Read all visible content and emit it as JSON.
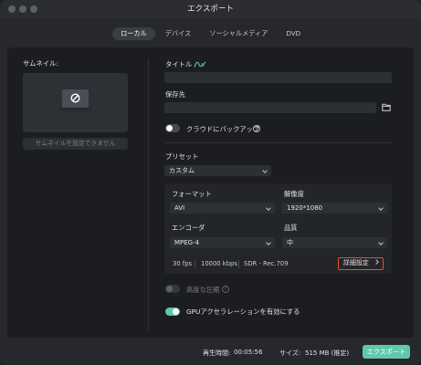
{
  "window": {
    "title": "エクスポート"
  },
  "tabs": [
    {
      "label": "ローカル",
      "active": true
    },
    {
      "label": "デバイス",
      "active": false
    },
    {
      "label": "ソーシャルメディア",
      "active": false
    },
    {
      "label": "DVD",
      "active": false
    }
  ],
  "thumbnail": {
    "label": "サムネイル:",
    "button_label": "サムネイルを設定できません"
  },
  "form": {
    "title_label": "タイトル",
    "title_value": "",
    "save_label": "保存先",
    "save_value": "",
    "backup_label": "クラウドにバックアップ",
    "backup_on": false
  },
  "preset": {
    "label": "プリセット",
    "value": "カスタム"
  },
  "format": {
    "format_label": "フォーマット",
    "format_value": "AVI",
    "resolution_label": "解像度",
    "resolution_value": "1920*1080",
    "encoder_label": "エンコーダ",
    "encoder_value": "MPEG-4",
    "quality_label": "品質",
    "quality_value": "中",
    "fps": "30 fps",
    "bitrate": "10000 kbps",
    "color": "SDR - Rec.709",
    "detail_label": "詳細設定"
  },
  "options": {
    "compress_label": "高度な圧縮",
    "compress_on": false,
    "gpu_label": "GPUアクセラレーションを有効にする",
    "gpu_on": true
  },
  "footer": {
    "duration_label": "再生時間:",
    "duration_value": "00:05:56",
    "size_label": "サイズ:",
    "size_value": "515 MB (推定)",
    "export_label": "エクスポート"
  },
  "colors": {
    "accent": "#5fc8a9",
    "highlight": "#e4502f"
  }
}
